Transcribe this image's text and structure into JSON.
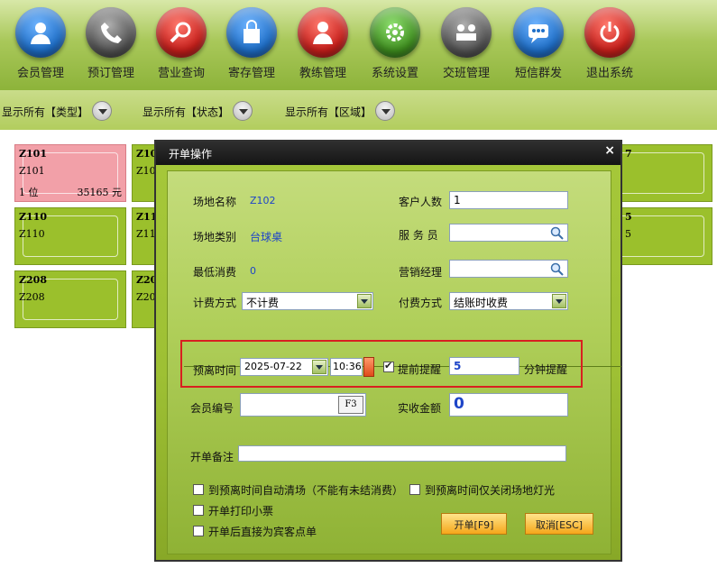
{
  "toolbar": {
    "items": [
      {
        "label": "会员管理",
        "icon": "member-icon",
        "color": "#1f6fc8"
      },
      {
        "label": "预订管理",
        "icon": "phone-icon",
        "color": "#555555"
      },
      {
        "label": "营业查询",
        "icon": "magnifier-icon",
        "color": "#c8201c"
      },
      {
        "label": "寄存管理",
        "icon": "bag-icon",
        "color": "#1f6fc8"
      },
      {
        "label": "教练管理",
        "icon": "coach-icon",
        "color": "#c8201c"
      },
      {
        "label": "系统设置",
        "icon": "gear-icon",
        "color": "#3f8e1f"
      },
      {
        "label": "交班管理",
        "icon": "shift-icon",
        "color": "#555555"
      },
      {
        "label": "短信群发",
        "icon": "sms-icon",
        "color": "#1f6fc8"
      },
      {
        "label": "退出系统",
        "icon": "power-icon",
        "color": "#c8201c"
      }
    ]
  },
  "filters": {
    "type": "显示所有【类型】",
    "status": "显示所有【状态】",
    "area": "显示所有【区域】"
  },
  "tiles": [
    {
      "code": "Z101",
      "name": "Z101",
      "position": "1 位",
      "amount": "35165 元",
      "color": "#f2a0a8"
    },
    {
      "code": "Z10",
      "name": "Z10",
      "color": "#9bc02c"
    },
    {
      "code": "Z110",
      "name": "Z110",
      "color": "#9bc02c"
    },
    {
      "code": "Z11",
      "name": "Z11",
      "color": "#9bc02c"
    },
    {
      "code": "Z208",
      "name": "Z208",
      "color": "#9bc02c"
    },
    {
      "code": "Z20",
      "name": "Z20",
      "color": "#9bc02c"
    },
    {
      "code": "7",
      "name": "",
      "color": "#9bc02c"
    },
    {
      "code": "5",
      "name": "5",
      "color": "#9bc02c"
    }
  ],
  "dialog": {
    "title": "开单操作",
    "close": "×",
    "venue_name_label": "场地名称",
    "venue_name": "Z102",
    "customer_count_label": "客户人数",
    "customer_count": "1",
    "venue_type_label": "场地类别",
    "venue_type": "台球桌",
    "waiter_label": "服 务 员",
    "waiter": "",
    "min_consume_label": "最低消费",
    "min_consume": "0",
    "manager_label": "营销经理",
    "manager": "",
    "billing_label": "计费方式",
    "billing": "不计费",
    "payment_label": "付费方式",
    "payment": "结账时收费",
    "leave_time_label": "预离时间",
    "leave_date": "2025-07-22",
    "leave_clock": "10:36",
    "remind_label": "提前提醒",
    "remind_checked": true,
    "remind_minutes": "5",
    "remind_suffix": "分钟提醒",
    "member_no_label": "会员编号",
    "member_no": "",
    "member_key": "F3",
    "paid_label": "实收金额",
    "paid": "0",
    "note_label": "开单备注",
    "note": "",
    "opt_auto_clear": "到预离时间自动清场（不能有未结消费）",
    "opt_lights_off": "到预离时间仅关闭场地灯光",
    "opt_print": "开单打印小票",
    "opt_guest_order": "开单后直接为宾客点单",
    "ok_label": "开单[F9]",
    "cancel_label": "取消[ESC]"
  }
}
